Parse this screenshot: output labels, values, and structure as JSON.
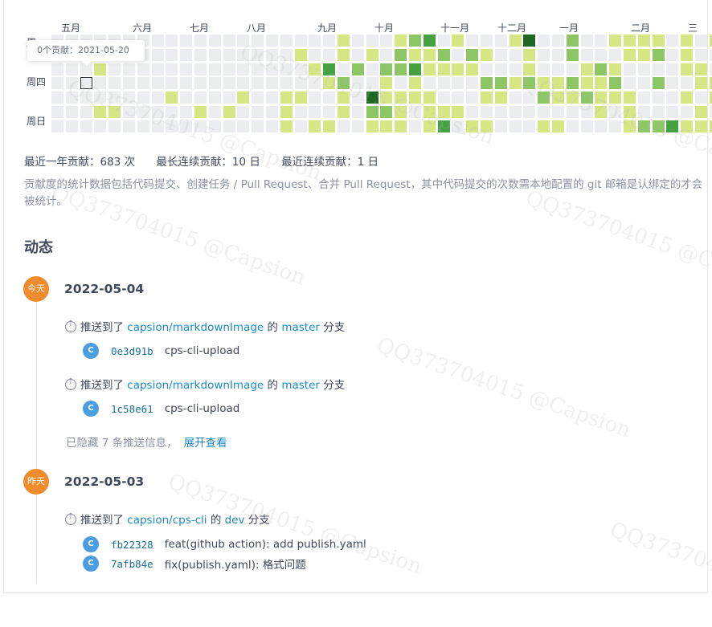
{
  "heatmap": {
    "months": [
      "五月",
      "六月",
      "七月",
      "八月",
      "九月",
      "十月",
      "十一月",
      "十二月",
      "一月",
      "二月",
      "三"
    ],
    "weekdays": [
      "周一",
      "周四",
      "周日"
    ],
    "tooltip": "0个贡献：2021-05-20",
    "colors": {
      "empty": "#ebedf0",
      "l1": "#d6e685",
      "l2": "#8cc665",
      "l3": "#44a340",
      "l4": "#1e6823"
    }
  },
  "stats": {
    "total": "最近一年贡献：683 次",
    "longest": "最长连续贡献：10 日",
    "recent": "最近连续贡献：1 日"
  },
  "note": "贡献度的统计数据包括代码提交、创建任务 / Pull Request、合并 Pull Request，其中代码提交的次数需本地配置的 git 邮箱是认绑定的才会被统计。",
  "section_title": "动态",
  "days": [
    {
      "badge": "今天",
      "date": "2022-05-04",
      "pushes": [
        {
          "prefix": "推送到了",
          "repo": "capsion/markdownImage",
          "mid": "的",
          "branch": "master",
          "suffix": "分支",
          "commits": [
            {
              "avatar": "C",
              "hash": "0e3d91b",
              "message": "cps-cli-upload"
            }
          ]
        },
        {
          "prefix": "推送到了",
          "repo": "capsion/markdownImage",
          "mid": "的",
          "branch": "master",
          "suffix": "分支",
          "commits": [
            {
              "avatar": "C",
              "hash": "1c58e61",
              "message": "cps-cli-upload"
            }
          ]
        }
      ],
      "hidden_text": "已隐藏 7 条推送信息，",
      "expand_label": "展开查看"
    },
    {
      "badge": "昨天",
      "date": "2022-05-03",
      "pushes": [
        {
          "prefix": "推送到了",
          "repo": "capsion/cps-cli",
          "mid": "的",
          "branch": "dev",
          "suffix": "分支",
          "commits": [
            {
              "avatar": "C",
              "hash": "fb22328",
              "message": "feat(github action): add publish.yaml"
            },
            {
              "avatar": "C",
              "hash": "7afb84e",
              "message": "fix(publish.yaml): 格式问题"
            }
          ]
        }
      ]
    }
  ],
  "watermark_text": "QQ373704015 @Capsion"
}
